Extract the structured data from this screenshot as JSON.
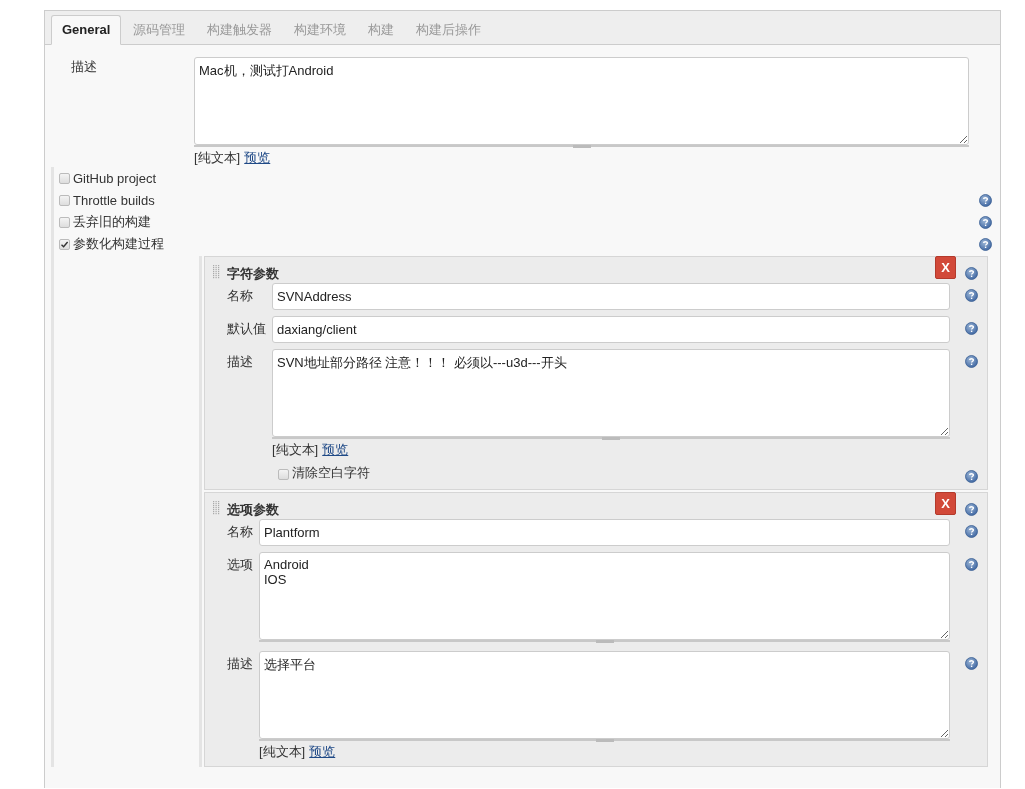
{
  "tabs": [
    {
      "label": "General",
      "selected": true
    },
    {
      "label": "源码管理",
      "selected": false
    },
    {
      "label": "构建触发器",
      "selected": false
    },
    {
      "label": "构建环境",
      "selected": false
    },
    {
      "label": "构建",
      "selected": false
    },
    {
      "label": "构建后操作",
      "selected": false
    }
  ],
  "description": {
    "label": "描述",
    "value": "Mac机，测试打Android",
    "format_label": "[纯文本]",
    "preview_link": "预览"
  },
  "options": [
    {
      "label": "GitHub project",
      "checked": false,
      "help": false
    },
    {
      "label": "Throttle builds",
      "checked": false,
      "help": true
    },
    {
      "label": "丢弃旧的构建",
      "checked": false,
      "help": true
    },
    {
      "label": "参数化构建过程",
      "checked": true,
      "help": true
    }
  ],
  "parameters": [
    {
      "title": "字符参数",
      "delete_label": "X",
      "help": true,
      "fields": [
        {
          "label": "名称",
          "kind": "input",
          "value": "SVNAddress",
          "help": true
        },
        {
          "label": "默认值",
          "kind": "input",
          "value": "daxiang/client",
          "help": true
        },
        {
          "label": "描述",
          "kind": "textarea",
          "value": "SVN地址部分路径 注意！！！ 必须以---u3d---开头",
          "help": true,
          "format_label": "[纯文本]",
          "preview_link": "预览"
        },
        {
          "label": "清除空白字符",
          "kind": "checkbox",
          "checked": false,
          "help": true
        }
      ]
    },
    {
      "title": "选项参数",
      "delete_label": "X",
      "help": true,
      "fields": [
        {
          "label": "名称",
          "kind": "input",
          "value": "Plantform",
          "help": true
        },
        {
          "label": "选项",
          "kind": "textarea",
          "value": "Android\nIOS",
          "help": true
        },
        {
          "label": "描述",
          "kind": "textarea",
          "value": "选择平台",
          "help": true,
          "format_label": "[纯文本]",
          "preview_link": "预览"
        }
      ]
    }
  ]
}
